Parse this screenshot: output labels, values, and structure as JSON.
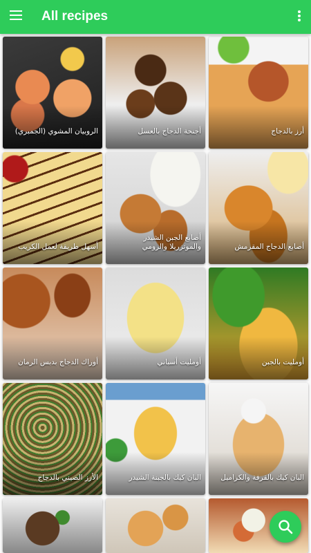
{
  "appbar": {
    "title": "All recipes",
    "menu_icon": "menu-icon",
    "more_icon": "more-vert-icon",
    "color": "#2ecc5a"
  },
  "recipes": [
    {
      "label": "الروبيان المشوي (الجمبري)"
    },
    {
      "label": "أجنحة الدجاج بالعسل"
    },
    {
      "label": "أرز بالدجاج"
    },
    {
      "label": "أسهل طريقة لعمل الكريب"
    },
    {
      "label": "أصابع الجبن الشيدر والموتزريلا والرومي"
    },
    {
      "label": "أصابع الدجاج المقرمش"
    },
    {
      "label": "أوراك الدجاج بدبس الرمان"
    },
    {
      "label": "أومليت أسباني"
    },
    {
      "label": "أومليت بالجبن"
    },
    {
      "label": "الأرز الصيني بالدجاج"
    },
    {
      "label": "البان كيك بالجبنة الشيدر"
    },
    {
      "label": "البان كيك بالقرفة والكراميل"
    },
    {
      "label": ""
    },
    {
      "label": ""
    },
    {
      "label": ""
    }
  ],
  "fab": {
    "icon": "search-icon",
    "color": "#2ecc5a"
  }
}
